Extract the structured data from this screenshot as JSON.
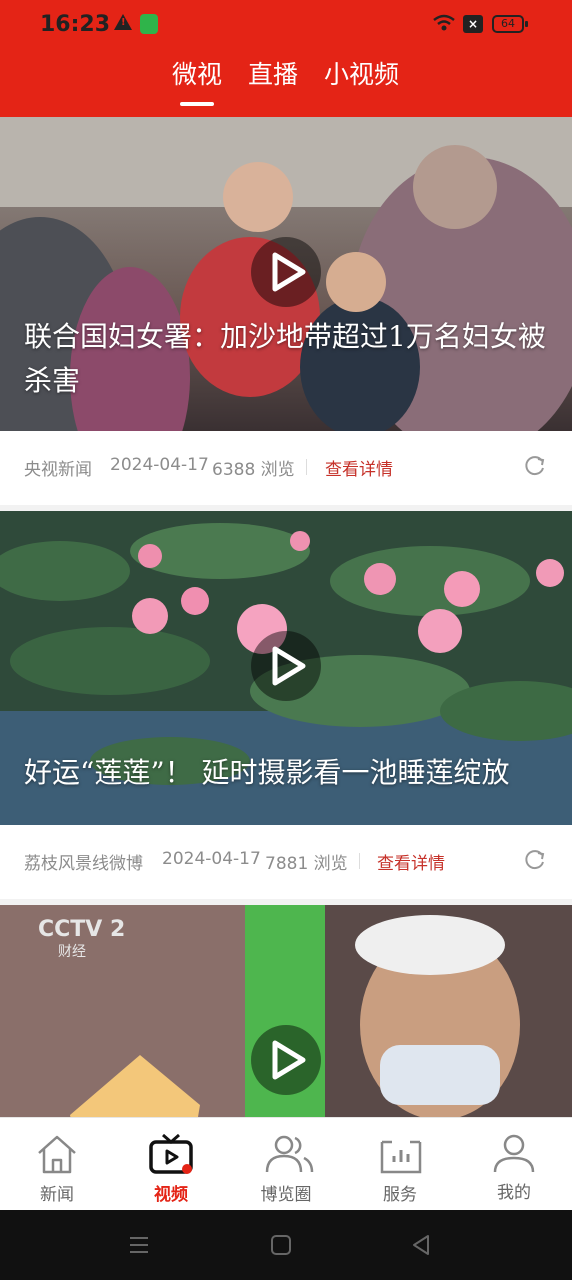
{
  "status_bar": {
    "time": "16:23",
    "battery": "64"
  },
  "tabs": [
    {
      "label": "微视",
      "active": true
    },
    {
      "label": "直播",
      "active": false
    },
    {
      "label": "小视频",
      "active": false
    }
  ],
  "feed": [
    {
      "title": "联合国妇女署：加沙地带超过1万名妇女被杀害",
      "source": "央视新闻",
      "date": "2024-04-17",
      "views": "6388 浏览",
      "detail": "查看详情"
    },
    {
      "title": "好运“莲莲”！ 延时摄影看一池睡莲绽放",
      "source": "荔枝风景线微博",
      "date": "2024-04-17",
      "views": "7881 浏览",
      "detail": "查看详情"
    },
    {
      "title": "",
      "channel_logo": "CCTV 2",
      "channel_sub": "财经"
    }
  ],
  "bottom_nav": [
    {
      "label": "新闻",
      "icon": "home-icon",
      "active": false
    },
    {
      "label": "视频",
      "icon": "tv-icon",
      "active": true
    },
    {
      "label": "博览圈",
      "icon": "people-icon",
      "active": false
    },
    {
      "label": "服务",
      "icon": "service-icon",
      "active": false
    },
    {
      "label": "我的",
      "icon": "user-icon",
      "active": false
    }
  ],
  "colors": {
    "brand": "#e42416",
    "detail_link": "#c6322a"
  }
}
